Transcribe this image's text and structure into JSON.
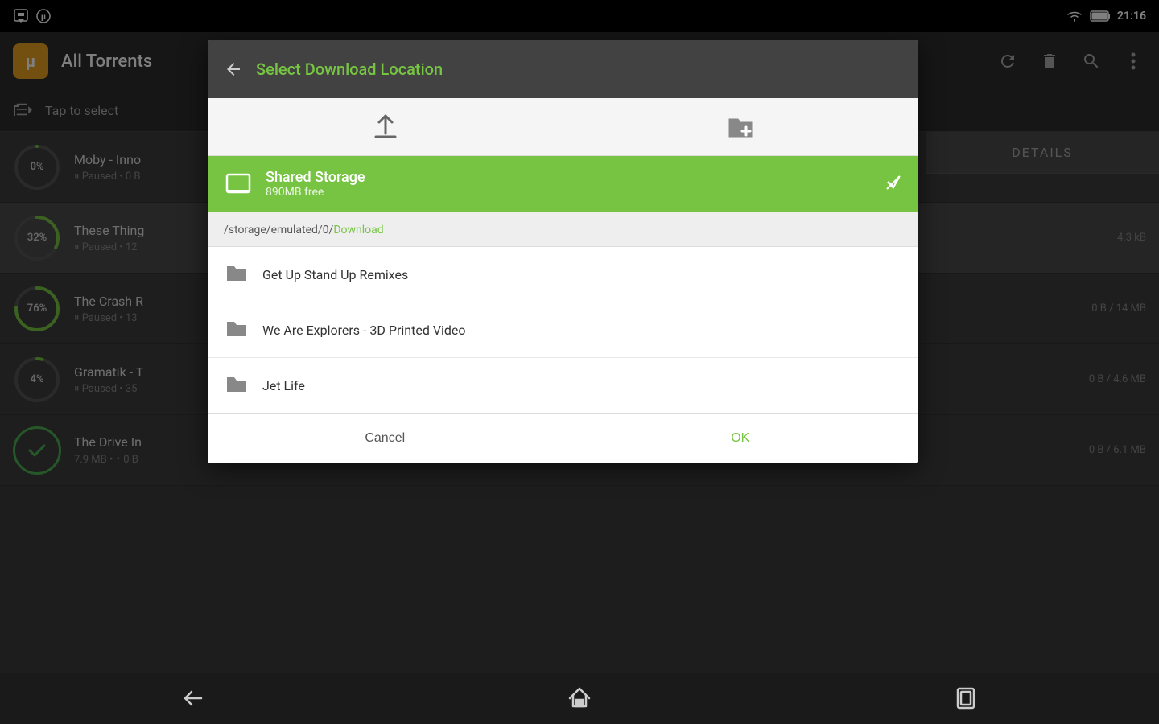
{
  "statusBar": {
    "time": "21:16",
    "leftIcons": [
      "download-icon",
      "utorrent-notif-icon"
    ]
  },
  "toolbar": {
    "appName": "μ",
    "title": "All Torrents",
    "actions": [
      "refresh-icon",
      "delete-icon",
      "search-icon",
      "more-icon"
    ]
  },
  "selectBar": {
    "icon": "select-icon",
    "label": "Tap to select"
  },
  "torrents": [
    {
      "id": 1,
      "name": "Moby - Inno",
      "status": "Paused • 0 B",
      "progress": 0,
      "size": "",
      "complete": false
    },
    {
      "id": 2,
      "name": "These Thing",
      "status": "Paused • 12",
      "progress": 32,
      "size": "4.3 kB",
      "complete": false,
      "highlighted": true
    },
    {
      "id": 3,
      "name": "The Crash R",
      "status": "Paused • 13",
      "progress": 76,
      "size": "0 B / 14 MB",
      "complete": false
    },
    {
      "id": 4,
      "name": "Gramatik - T",
      "status": "Paused • 35",
      "progress": 4,
      "size": "0 B / 4.6 MB",
      "complete": false
    },
    {
      "id": 5,
      "name": "The Drive In",
      "status": "7.9 MB • ↑ 0 B",
      "progress": 100,
      "size": "0 B / 6.1 MB",
      "complete": true
    }
  ],
  "dialog": {
    "backLabel": "‹",
    "title": "Select Download Location",
    "uploadIconLabel": "↑",
    "newFolderIconLabel": "🗂",
    "selectedStorage": {
      "name": "Shared Storage",
      "free": "890MB free"
    },
    "currentPath": "/storage/emulated/0/",
    "currentPathHighlight": "Download",
    "folders": [
      {
        "name": "Get Up Stand Up Remixes"
      },
      {
        "name": "We Are Explorers - 3D Printed Video"
      },
      {
        "name": "Jet Life"
      }
    ],
    "cancelLabel": "Cancel",
    "okLabel": "OK"
  },
  "bottomNav": {
    "back": "←",
    "home": "⌂",
    "recent": "▭"
  }
}
